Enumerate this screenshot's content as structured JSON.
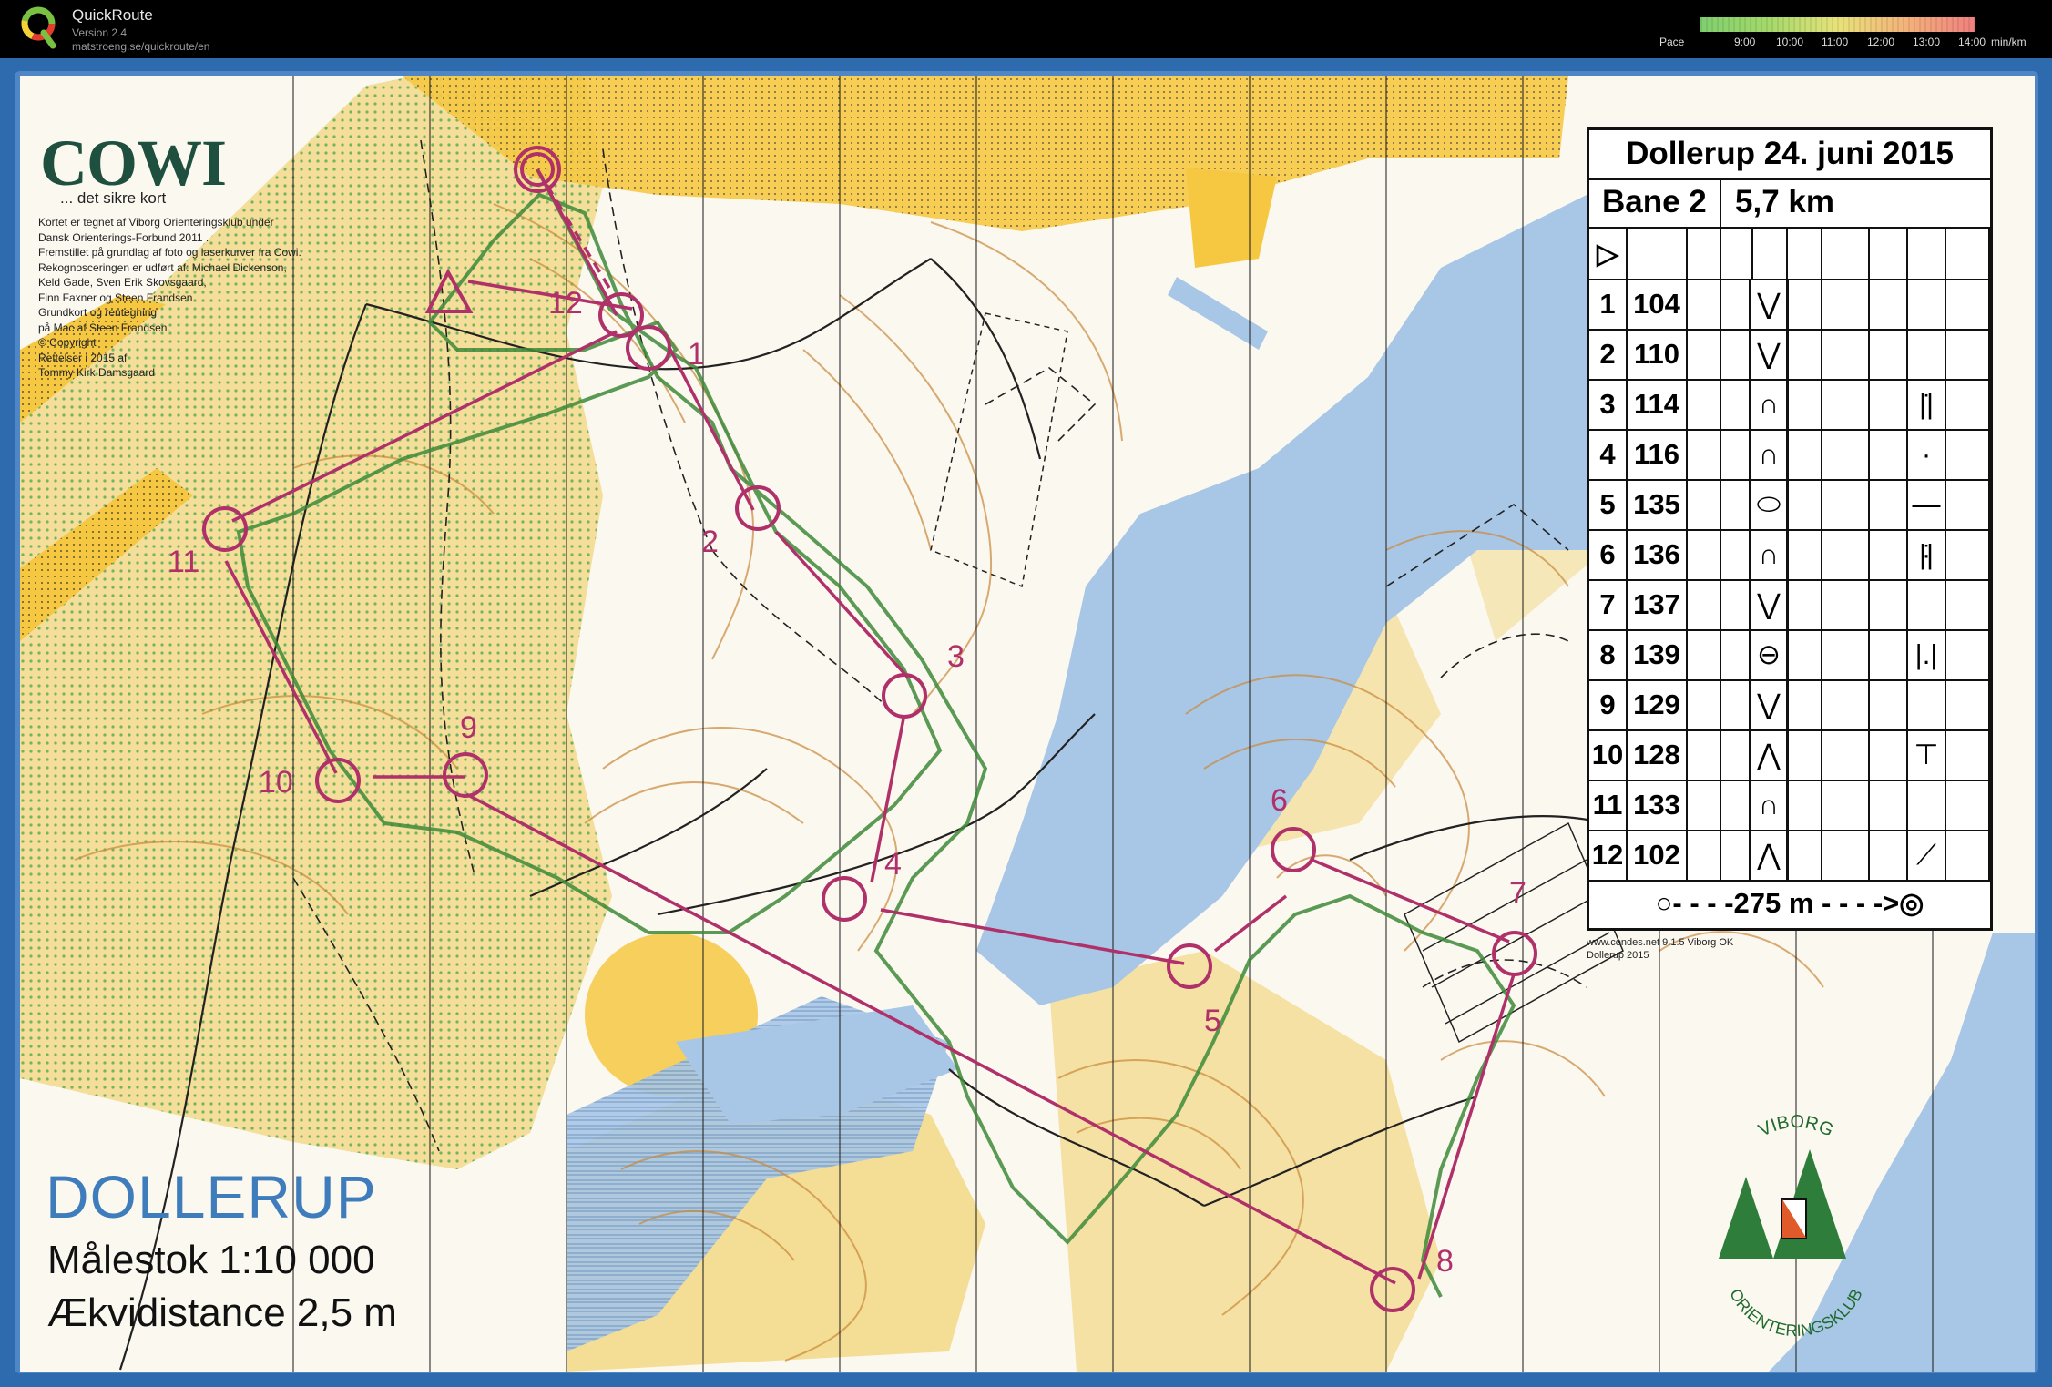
{
  "app": {
    "name": "QuickRoute",
    "version": "Version 2.4",
    "url": "matstroeng.se/quickroute/en"
  },
  "pace_scale": {
    "label": "Pace",
    "ticks": [
      "9:00",
      "10:00",
      "11:00",
      "12:00",
      "13:00",
      "14:00"
    ],
    "unit": "min/km"
  },
  "map": {
    "brand": "COWI",
    "brand_tagline": "... det sikre kort",
    "credits": "Kortet er tegnet af Viborg Orienteringsklub under\nDansk Orienterings-Forbund  2011 .\nFremstillet på grundlag af foto og laserkurver fra Cowi.\nRekognosceringen er udført af: Michael Dickenson,\nKeld Gade, Sven Erik Skovsgaard,\nFinn Faxner og Steen Frandsen\nGrundkort og rentegning\npå Mac af Steen Frandsen.\n© Copyright\nRettelser i 2015 af\nTommy Kirk Damsgaard",
    "area_name": "DOLLERUP",
    "scale_text": "Målestok  1:10 000",
    "equidistance_text": "Ækvidistance  2,5 m",
    "source_note_1": "www.condes.net 9.1.5 Viborg OK",
    "source_note_2": "Dollerup 2015",
    "club_name_top": "VIBORG",
    "club_name_bottom": "ORIENTERINGSKLUB",
    "control_labels": [
      "1",
      "2",
      "3",
      "4",
      "5",
      "6",
      "7",
      "8",
      "9",
      "10",
      "11",
      "12"
    ],
    "colors": {
      "course": "#b0306a",
      "route": "#3d8a3a",
      "water": "#a8c6e6",
      "open_land": "#f3d98a",
      "rough_open": "#f6c842",
      "forest": "#fbf8f0",
      "contour": "#c9893a",
      "frame": "#2d6aae"
    }
  },
  "control_description": {
    "event": "Dollerup 24. juni 2015",
    "course": "Bane 2",
    "length": "5,7 km",
    "start_symbol": "▷",
    "rows": [
      {
        "num": "1",
        "code": "104",
        "feature": "⋁",
        "detail": ""
      },
      {
        "num": "2",
        "code": "110",
        "feature": "⋁",
        "detail": ""
      },
      {
        "num": "3",
        "code": "114",
        "feature": "∩",
        "detail": "|̇|"
      },
      {
        "num": "4",
        "code": "116",
        "feature": "∩",
        "detail": "·—·"
      },
      {
        "num": "5",
        "code": "135",
        "feature": "⬭",
        "detail": ""
      },
      {
        "num": "6",
        "code": "136",
        "feature": "∩",
        "detail": "|̇|"
      },
      {
        "num": "7",
        "code": "137",
        "feature": "⋁",
        "detail": ""
      },
      {
        "num": "8",
        "code": "139",
        "feature": "⊖",
        "detail": "|.|"
      },
      {
        "num": "9",
        "code": "129",
        "feature": "⋁",
        "detail": ""
      },
      {
        "num": "10",
        "code": "128",
        "feature": "⋀",
        "detail": "⊤"
      },
      {
        "num": "11",
        "code": "133",
        "feature": "∩",
        "detail": ""
      },
      {
        "num": "12",
        "code": "102",
        "feature": "⋀",
        "detail": "⟋"
      }
    ],
    "finish_text": "○- - - -275 m - - - ->◎"
  }
}
